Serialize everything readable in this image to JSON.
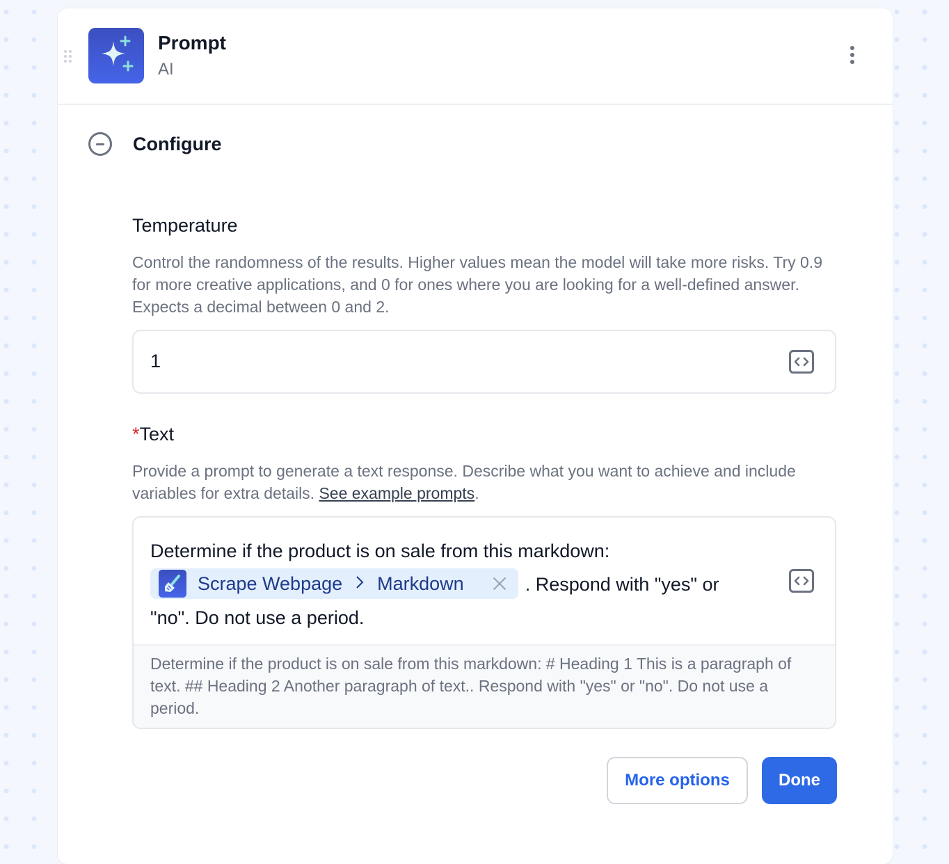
{
  "step": {
    "title": "Prompt",
    "subtitle": "AI",
    "icon": "sparkles-icon",
    "menu_icon": "kebab-menu-icon"
  },
  "section": {
    "title": "Configure",
    "toggle_icon": "collapse-minus-icon"
  },
  "fields": {
    "temperature": {
      "label": "Temperature",
      "description": "Control the randomness of the results. Higher values mean the model will take more risks. Try 0.9 for more creative applications, and 0 for ones where you are looking for a well-defined answer. Expects a decimal between 0 and 2.",
      "value": "1",
      "action_icon": "code-brackets-icon"
    },
    "text": {
      "required_mark": "*",
      "label": "Text",
      "description_prefix": "Provide a prompt to generate a text response. Describe what you want to achieve and include variables for extra details. ",
      "description_link": "See example prompts",
      "description_suffix": ".",
      "value_before": "Determine if the product is on sale from this markdown: ",
      "variable": {
        "source": "Scrape Webpage",
        "separator": ">",
        "field": "Markdown",
        "icon": "scraper-tool-icon",
        "remove_icon": "close-icon"
      },
      "value_after": ". Respond with \"yes\" or \"no\". Do not use a period.",
      "preview": "Determine if the product is on sale from this markdown: # Heading 1 This is a paragraph of text. ## Heading 2 Another paragraph of text.. Respond with \"yes\" or \"no\". Do not use a period.",
      "action_icon": "code-brackets-icon"
    }
  },
  "actions": {
    "more_options": "More options",
    "done": "Done"
  },
  "colors": {
    "primary": "#2f6ae6",
    "chip_bg": "#e3effd",
    "required": "#dc2626"
  }
}
